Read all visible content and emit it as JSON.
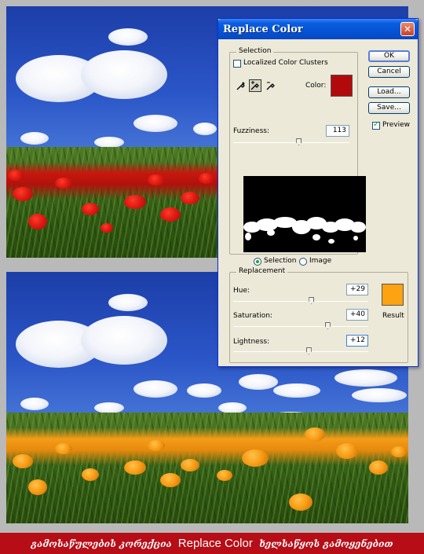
{
  "dialog": {
    "title": "Replace Color",
    "close_symbol": "✕",
    "selection": {
      "group_label": "Selection",
      "localized_checkbox_label": "Localized Color Clusters",
      "localized_checked": false,
      "color_label": "Color:",
      "color_swatch": "#b20a0c",
      "fuzziness_label": "Fuzziness:",
      "fuzziness_value": "113",
      "fuzziness_fraction": 0.565,
      "view_selection_label": "Selection",
      "view_image_label": "Image",
      "view_selected": "Selection",
      "eyedropper_icons": [
        "eyedropper-icon",
        "eyedropper-add-icon",
        "eyedropper-subtract-icon"
      ]
    },
    "replacement": {
      "group_label": "Replacement",
      "hue_label": "Hue:",
      "hue_value": "+29",
      "hue_fraction": 0.58,
      "saturation_label": "Saturation:",
      "saturation_value": "+40",
      "saturation_fraction": 0.7,
      "lightness_label": "Lightness:",
      "lightness_value": "+12",
      "lightness_fraction": 0.56,
      "result_label": "Result",
      "result_swatch": "#fda311"
    },
    "buttons": {
      "ok": "OK",
      "cancel": "Cancel",
      "load": "Load...",
      "save": "Save..."
    },
    "preview_label": "Preview",
    "preview_checked": true
  },
  "banner": {
    "geo_left": "გამოსაწულების კორექცია",
    "latin": "Replace Color",
    "geo_right": "ხელსაწყოს გამოყენებით",
    "background": "#b60d17"
  }
}
